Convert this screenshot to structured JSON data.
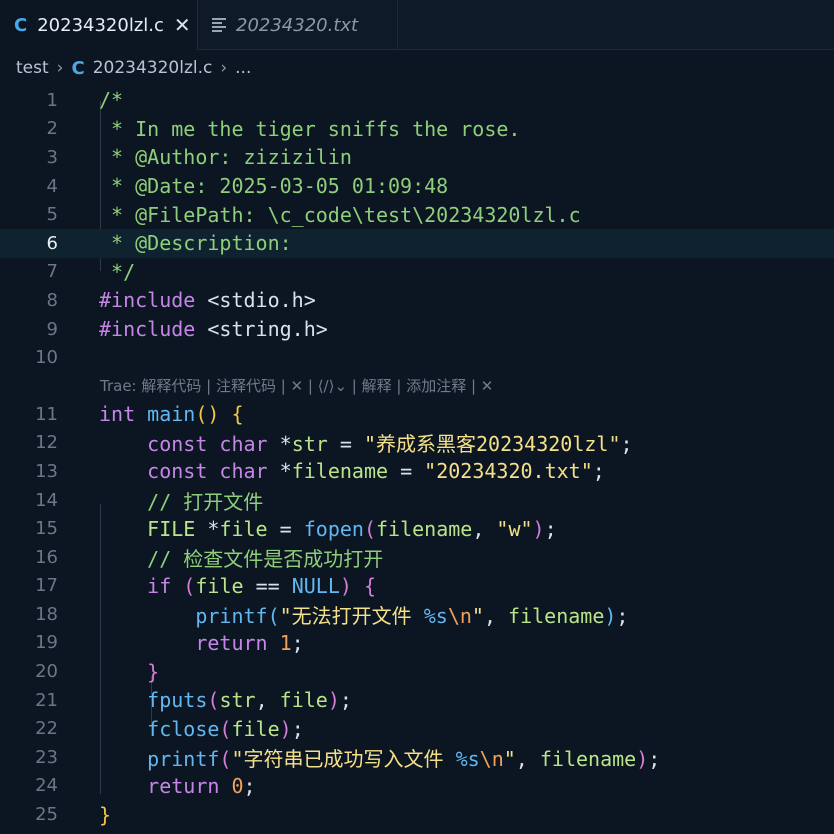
{
  "tabs": [
    {
      "icon": "C",
      "label": "20234320lzl.c",
      "active": true,
      "close": "✕"
    },
    {
      "label": "20234320.txt",
      "active": false
    }
  ],
  "breadcrumb": {
    "folder": "test",
    "icon": "C",
    "file": "20234320lzl.c",
    "more": "..."
  },
  "codelens": "Trae: 解释代码 | 注释代码 | ✕ | ⟨/⟩⌄ | 解释 | 添加注释 | ✕",
  "line_numbers": [
    "1",
    "2",
    "3",
    "4",
    "5",
    "6",
    "7",
    "8",
    "9",
    "10",
    "11",
    "12",
    "13",
    "14",
    "15",
    "16",
    "17",
    "18",
    "19",
    "20",
    "21",
    "22",
    "23",
    "24",
    "25"
  ],
  "current_line": "6",
  "code": {
    "l1": "/*",
    "l2": " * In me the tiger sniffs the rose.",
    "l3": " * @Author: zizizilin",
    "l4": " * @Date: 2025-03-05 01:09:48",
    "l5": " * @FilePath: \\c_code\\test\\20234320lzl.c",
    "l6": " * @Description: ",
    "l7": " */",
    "l8_inc": "#include",
    "l8_hdr": " <stdio.h>",
    "l9_inc": "#include",
    "l9_hdr": " <string.h>",
    "l11_int": "int",
    "l11_main": " main",
    "l11_p": "()",
    "l11_b": " {",
    "l12_const": "const",
    "l12_char": " char",
    "l12_rest": " *",
    "l12_var": "str",
    "l12_eq": " = ",
    "l12_str": "\"养成系黑客20234320lzl\"",
    "l12_end": ";",
    "l13_const": "const",
    "l13_char": " char",
    "l13_rest": " *",
    "l13_var": "filename",
    "l13_eq": " = ",
    "l13_str": "\"20234320.txt\"",
    "l13_end": ";",
    "l14": "// 打开文件",
    "l15_type": "FILE",
    "l15_star": " *",
    "l15_var": "file",
    "l15_eq": " = ",
    "l15_fn": "fopen",
    "l15_p1": "(",
    "l15_arg": "filename",
    "l15_comma": ", ",
    "l15_str": "\"w\"",
    "l15_p2": ")",
    "l15_end": ";",
    "l16": "// 检查文件是否成功打开",
    "l17_if": "if",
    "l17_p1": " (",
    "l17_var": "file",
    "l17_op": " == ",
    "l17_null": "NULL",
    "l17_p2": ")",
    "l17_b": " {",
    "l18_fn": "printf",
    "l18_p1": "(",
    "l18_s1": "\"无法打开文件 ",
    "l18_fmt": "%s",
    "l18_esc": "\\n",
    "l18_s2": "\"",
    "l18_comma": ", ",
    "l18_var": "filename",
    "l18_p2": ")",
    "l18_end": ";",
    "l19_ret": "return",
    "l19_num": " 1",
    "l19_end": ";",
    "l20": "}",
    "l21_fn": "fputs",
    "l21_p1": "(",
    "l21_a1": "str",
    "l21_comma": ", ",
    "l21_a2": "file",
    "l21_p2": ")",
    "l21_end": ";",
    "l22_fn": "fclose",
    "l22_p1": "(",
    "l22_a1": "file",
    "l22_p2": ")",
    "l22_end": ";",
    "l23_fn": "printf",
    "l23_p1": "(",
    "l23_s1": "\"字符串已成功写入文件 ",
    "l23_fmt": "%s",
    "l23_esc": "\\n",
    "l23_s2": "\"",
    "l23_comma": ", ",
    "l23_var": "filename",
    "l23_p2": ")",
    "l23_end": ";",
    "l24_ret": "return",
    "l24_num": " 0",
    "l24_end": ";",
    "l25": "}"
  },
  "colors": {
    "background": "#0b1622",
    "comment": "#8fce7a",
    "keyword": "#c686e8",
    "function": "#62b7f0",
    "string": "#f5e089",
    "number": "#f0a05a"
  }
}
